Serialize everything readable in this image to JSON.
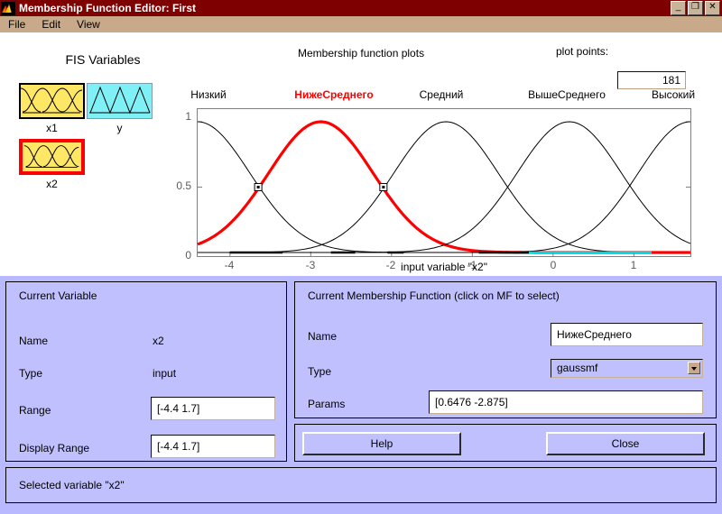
{
  "window": {
    "title": "Membership Function Editor: First",
    "icon": "matlab-membrane-icon",
    "buttons": {
      "minimize": "_",
      "maximize": "❐",
      "close": "✕"
    },
    "titlebar_color": "#7e0000"
  },
  "menu": {
    "items": [
      "File",
      "Edit",
      "View"
    ]
  },
  "fis_variables": {
    "title": "FIS Variables",
    "items": [
      {
        "label": "x1",
        "kind": "input",
        "selected": false,
        "color": "#ffe766"
      },
      {
        "label": "y",
        "kind": "output",
        "selected": false,
        "color": "#7ff0f5"
      },
      {
        "label": "x2",
        "kind": "input",
        "selected": true,
        "color": "#ffe766"
      }
    ],
    "selection_color": "#ff0000"
  },
  "plot_header": {
    "title": "Membership function plots",
    "plot_points_label": "plot points:",
    "plot_points_value": "181"
  },
  "chart_data": {
    "type": "line",
    "title": "Membership function plots",
    "xlabel": "input variable \"x2\"",
    "ylabel": "",
    "xlim": [
      -4.4,
      1.7
    ],
    "ylim": [
      0,
      1
    ],
    "xticks": [
      -4,
      -3,
      -2,
      -1,
      0,
      1
    ],
    "xticklabels": [
      "-4",
      "-3",
      "-2",
      "-1",
      "0",
      "1"
    ],
    "yticks": [
      0,
      0.5,
      1
    ],
    "yticklabels": [
      "0",
      "0.5",
      "1"
    ],
    "grid": false,
    "legend": "inline-above-axes",
    "mf_type": "gaussmf",
    "series": [
      {
        "name": "Низкий",
        "selected": false,
        "color": "#000000",
        "sigma": 0.6476,
        "center": -4.4,
        "label_x": -4.25
      },
      {
        "name": "НижеСреднего",
        "selected": true,
        "color": "#ff0000",
        "sigma": 0.6476,
        "center": -2.875,
        "label_x": -3.1
      },
      {
        "name": "Средний",
        "selected": false,
        "color": "#000000",
        "sigma": 0.6476,
        "center": -1.325,
        "label_x": -1.78
      },
      {
        "name": "ВышеСреднего",
        "selected": false,
        "color": "#000000",
        "sigma": 0.6476,
        "center": 0.2,
        "label_x": -0.25
      },
      {
        "name": "Высокий",
        "selected": false,
        "color": "#000000",
        "sigma": 0.6476,
        "center": 1.7,
        "label_x": 1.48
      }
    ],
    "drag_handles": [
      {
        "x": -3.65,
        "y": 0.5
      },
      {
        "x": -2.1,
        "y": 0.5
      }
    ]
  },
  "current_variable": {
    "panel_title": "Current Variable",
    "name_label": "Name",
    "name_value": "x2",
    "type_label": "Type",
    "type_value": "input",
    "range_label": "Range",
    "range_value": "[-4.4 1.7]",
    "display_range_label": "Display Range",
    "display_range_value": "[-4.4 1.7]"
  },
  "current_mf": {
    "panel_title": "Current Membership Function (click on MF to select)",
    "name_label": "Name",
    "name_value": "НижеСреднего",
    "type_label": "Type",
    "type_value": "gaussmf",
    "params_label": "Params",
    "params_value": "[0.6476 -2.875]"
  },
  "actions": {
    "help": "Help",
    "close": "Close"
  },
  "status": {
    "text": "Selected variable \"x2\""
  }
}
